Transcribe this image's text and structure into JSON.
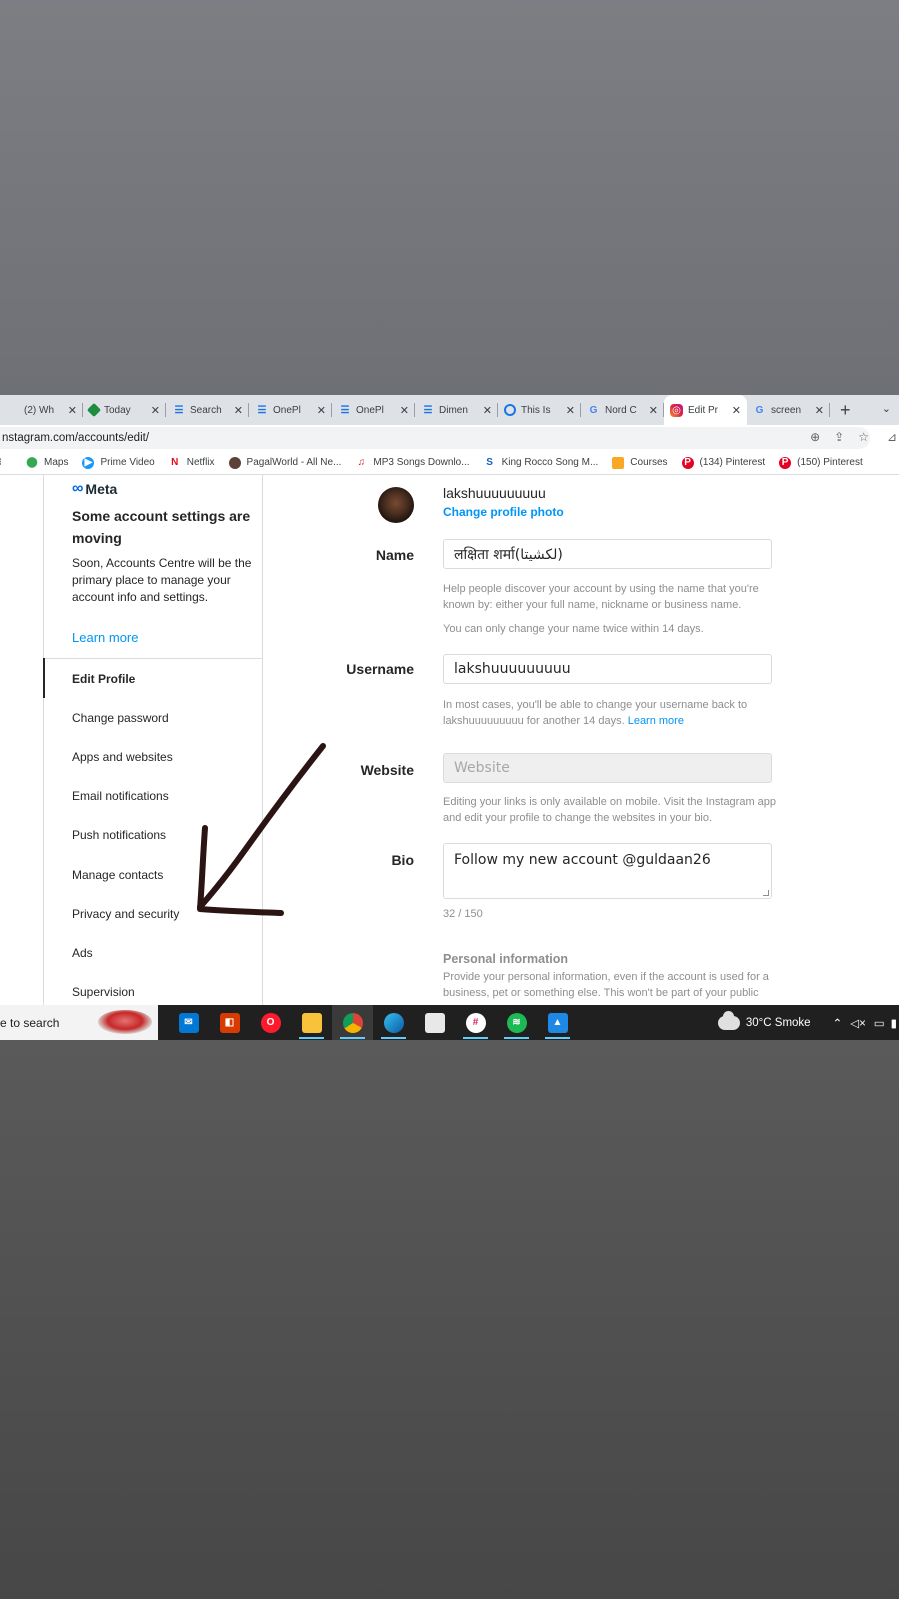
{
  "browser": {
    "tabs": [
      {
        "title": "(2) Wh",
        "icon": "whatsapp-icon",
        "active": false
      },
      {
        "title": "Today",
        "icon": "today-icon",
        "active": false
      },
      {
        "title": "Search",
        "icon": "bars-icon",
        "active": false
      },
      {
        "title": "OnePl",
        "icon": "bars-icon",
        "active": false
      },
      {
        "title": "OnePl",
        "icon": "bars-icon",
        "active": false
      },
      {
        "title": "Dimen",
        "icon": "bars-icon",
        "active": false
      },
      {
        "title": "This Is",
        "icon": "ms-icon",
        "active": false
      },
      {
        "title": "Nord C",
        "icon": "google-icon",
        "active": false
      },
      {
        "title": "Edit Pr",
        "icon": "instagram-icon",
        "active": true
      },
      {
        "title": "screen",
        "icon": "google-icon",
        "active": false
      }
    ],
    "close_glyph": "✕",
    "new_tab_glyph": "+",
    "url": "nstagram.com/accounts/edit/",
    "bookmarks": [
      {
        "label": "",
        "icon": "apps-icon"
      },
      {
        "label": "Maps",
        "icon": "maps-icon"
      },
      {
        "label": "Prime Video",
        "icon": "prime-video-icon"
      },
      {
        "label": "Netflix",
        "icon": "netflix-icon"
      },
      {
        "label": "PagalWorld - All Ne...",
        "icon": "pagalworld-icon"
      },
      {
        "label": "MP3 Songs Downlo...",
        "icon": "music-icon"
      },
      {
        "label": "King Rocco Song M...",
        "icon": "s-icon"
      },
      {
        "label": "Courses",
        "icon": "courses-icon"
      },
      {
        "label": "(134) Pinterest",
        "icon": "pinterest-icon"
      },
      {
        "label": "(150) Pinterest",
        "icon": "pinterest-icon"
      }
    ]
  },
  "sidebar": {
    "meta_logo": "Meta",
    "title": "Some account settings are moving",
    "description": "Soon, Accounts Centre will be the primary place to manage your account info and settings.",
    "learn_more": "Learn more",
    "items": [
      {
        "label": "Edit Profile",
        "active": true
      },
      {
        "label": "Change password"
      },
      {
        "label": "Apps and websites"
      },
      {
        "label": "Email notifications"
      },
      {
        "label": "Push notifications"
      },
      {
        "label": "Manage contacts"
      },
      {
        "label": "Privacy and security"
      },
      {
        "label": "Ads"
      },
      {
        "label": "Supervision"
      }
    ]
  },
  "profile": {
    "username": "lakshuuuuuuuuu",
    "change_photo": "Change profile photo"
  },
  "form": {
    "name_label": "Name",
    "name_value": "लक्षिता शर्मा(لکشیتا)",
    "name_help_1": "Help people discover your account by using the name that you're known by: either your full name, nickname or business name.",
    "name_help_2": "You can only change your name twice within 14 days.",
    "username_label": "Username",
    "username_value": "lakshuuuuuuuuu",
    "username_help": "In most cases, you'll be able to change your username back to lakshuuuuuuuuu for another 14 days.",
    "username_help_link": "Learn more",
    "website_label": "Website",
    "website_placeholder": "Website",
    "website_help": "Editing your links is only available on mobile. Visit the Instagram app and edit your profile to change the websites in your bio.",
    "bio_label": "Bio",
    "bio_value": "Follow my new account @guldaan26",
    "bio_count": "32 / 150",
    "personal_title": "Personal information",
    "personal_help": "Provide your personal information, even if the account is used for a business, pet or something else. This won't be part of your public"
  },
  "taskbar": {
    "search_text": "e to search",
    "apps": [
      "mail-icon",
      "office-icon",
      "opera-icon",
      "file-explorer-icon",
      "chrome-icon",
      "edge-icon",
      "store-icon",
      "slack-icon",
      "spotify-icon",
      "photos-icon"
    ],
    "weather": "30°C  Smoke"
  },
  "colors": {
    "link": "#0095f6",
    "taskbar": "#202020",
    "arrow": "#2b1414"
  }
}
